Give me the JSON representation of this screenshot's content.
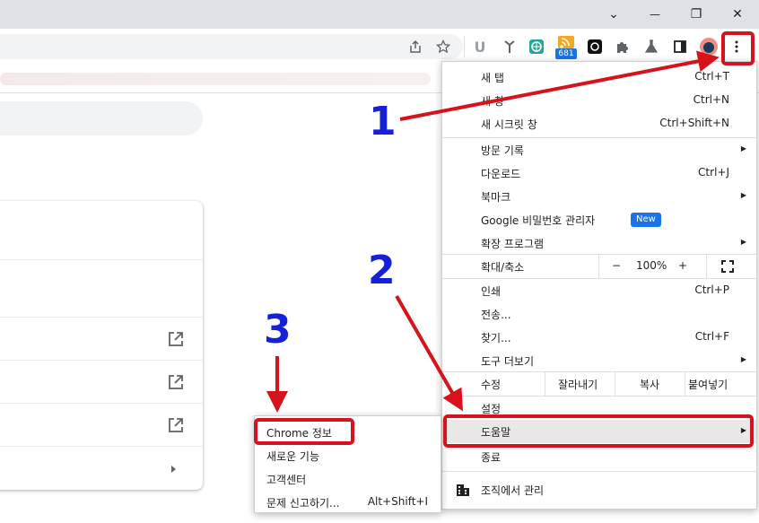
{
  "window": {
    "minimize_glyph": "—",
    "tab_search_glyph": "⌄",
    "restore_glyph": "❐",
    "close_glyph": "✕"
  },
  "toolbar": {
    "ext_badge_count": "681"
  },
  "menu": {
    "items": [
      {
        "label": "새 탭",
        "shortcut": "Ctrl+T"
      },
      {
        "label": "새 창",
        "shortcut": "Ctrl+N"
      },
      {
        "label": "새 시크릿 창",
        "shortcut": "Ctrl+Shift+N"
      },
      {
        "label": "방문 기록",
        "shortcut": ""
      },
      {
        "label": "다운로드",
        "shortcut": "Ctrl+J"
      },
      {
        "label": "북마크",
        "shortcut": ""
      },
      {
        "label": "Google 비밀번호 관리자",
        "shortcut": ""
      },
      {
        "label": "확장 프로그램",
        "shortcut": ""
      },
      {
        "label": "인쇄",
        "shortcut": "Ctrl+P"
      },
      {
        "label": "전송...",
        "shortcut": ""
      },
      {
        "label": "찾기...",
        "shortcut": "Ctrl+F"
      },
      {
        "label": "도구 더보기",
        "shortcut": ""
      },
      {
        "label": "설정",
        "shortcut": ""
      },
      {
        "label": "도움말",
        "shortcut": ""
      },
      {
        "label": "종료",
        "shortcut": ""
      },
      {
        "label": "조직에서 관리",
        "shortcut": ""
      }
    ],
    "new_badge": "New",
    "zoom": {
      "label": "확대/축소",
      "minus": "−",
      "value": "100%",
      "plus": "+"
    },
    "edit": {
      "label": "수정",
      "cut": "잘라내기",
      "copy": "복사",
      "paste": "붙여넣기"
    }
  },
  "help_submenu": {
    "items": [
      {
        "label": "Chrome 정보",
        "shortcut": ""
      },
      {
        "label": "새로운 기능",
        "shortcut": ""
      },
      {
        "label": "고객센터",
        "shortcut": ""
      },
      {
        "label": "문제 신고하기...",
        "shortcut": "Alt+Shift+I"
      }
    ]
  },
  "annotations": {
    "step1": "1",
    "step2": "2",
    "step3": "3",
    "color": "#d6121b",
    "number_color": "#1521d8"
  },
  "colors": {
    "titlebar": "#dee1e6",
    "highlight": "#e8e8e8",
    "new_badge": "#1a73e8"
  }
}
